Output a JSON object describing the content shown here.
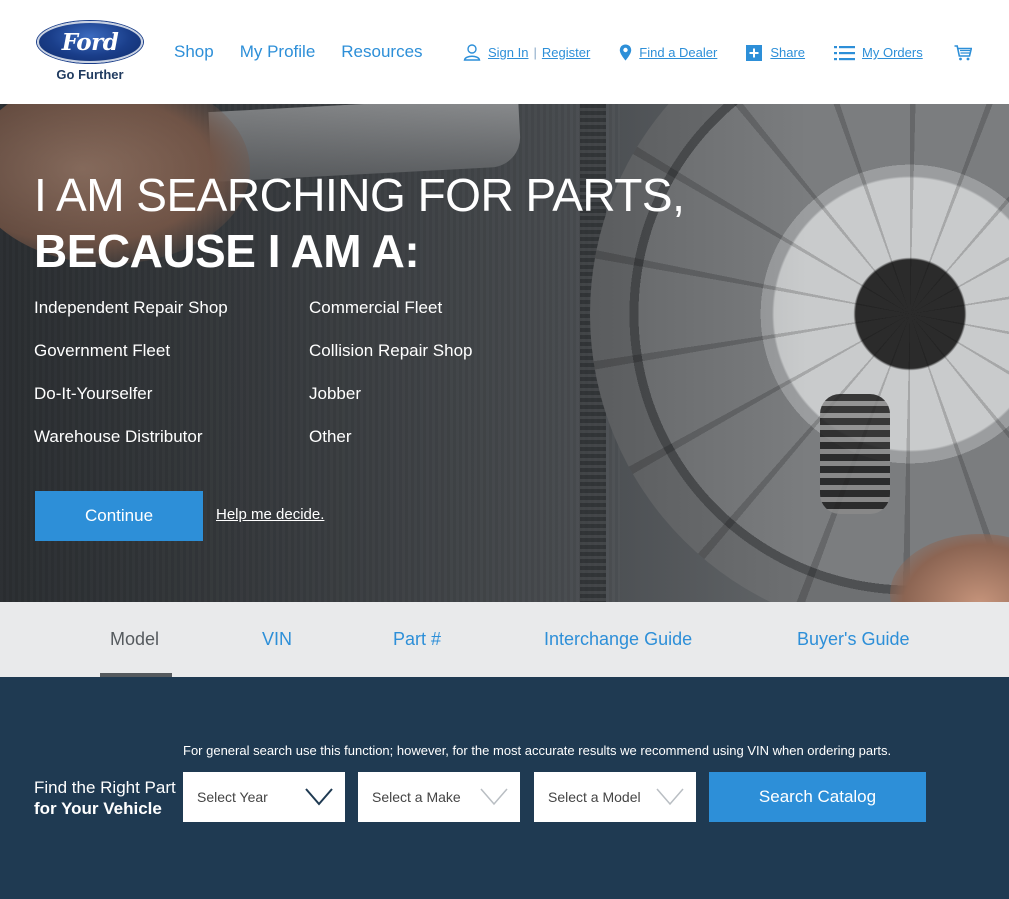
{
  "header": {
    "logo_text": "Ford",
    "tagline": "Go Further",
    "main_nav": [
      "Shop",
      "My Profile",
      "Resources"
    ],
    "sign_in": "Sign In",
    "register": "Register",
    "find_dealer": "Find a Dealer",
    "share": "Share",
    "my_orders": "My Orders"
  },
  "hero": {
    "headline_1": "I AM SEARCHING FOR PARTS,",
    "headline_2": "BECAUSE I AM A:",
    "roles": [
      "Independent Repair Shop",
      "Commercial Fleet",
      "Government Fleet",
      "Collision Repair Shop",
      "Do-It-Yourselfer",
      "Jobber",
      "Warehouse Distributor",
      "Other"
    ],
    "continue_label": "Continue",
    "help_link": "Help me decide."
  },
  "tabs": {
    "items": [
      "Model",
      "VIN",
      "Part #",
      "Interchange Guide",
      "Buyer's Guide"
    ],
    "active": "Model"
  },
  "search": {
    "note": "For general search use this function; however, for the most accurate results we recommend using VIN when ordering parts.",
    "label_line1": "Find the Right Part",
    "label_line2": "for Your Vehicle",
    "year_placeholder": "Select Year",
    "make_placeholder": "Select a Make",
    "model_placeholder": "Select a Model",
    "button_label": "Search Catalog"
  },
  "colors": {
    "accent": "#2d8fd8",
    "panel": "#1f3a52",
    "tabs_bg": "#e9eaeb"
  }
}
